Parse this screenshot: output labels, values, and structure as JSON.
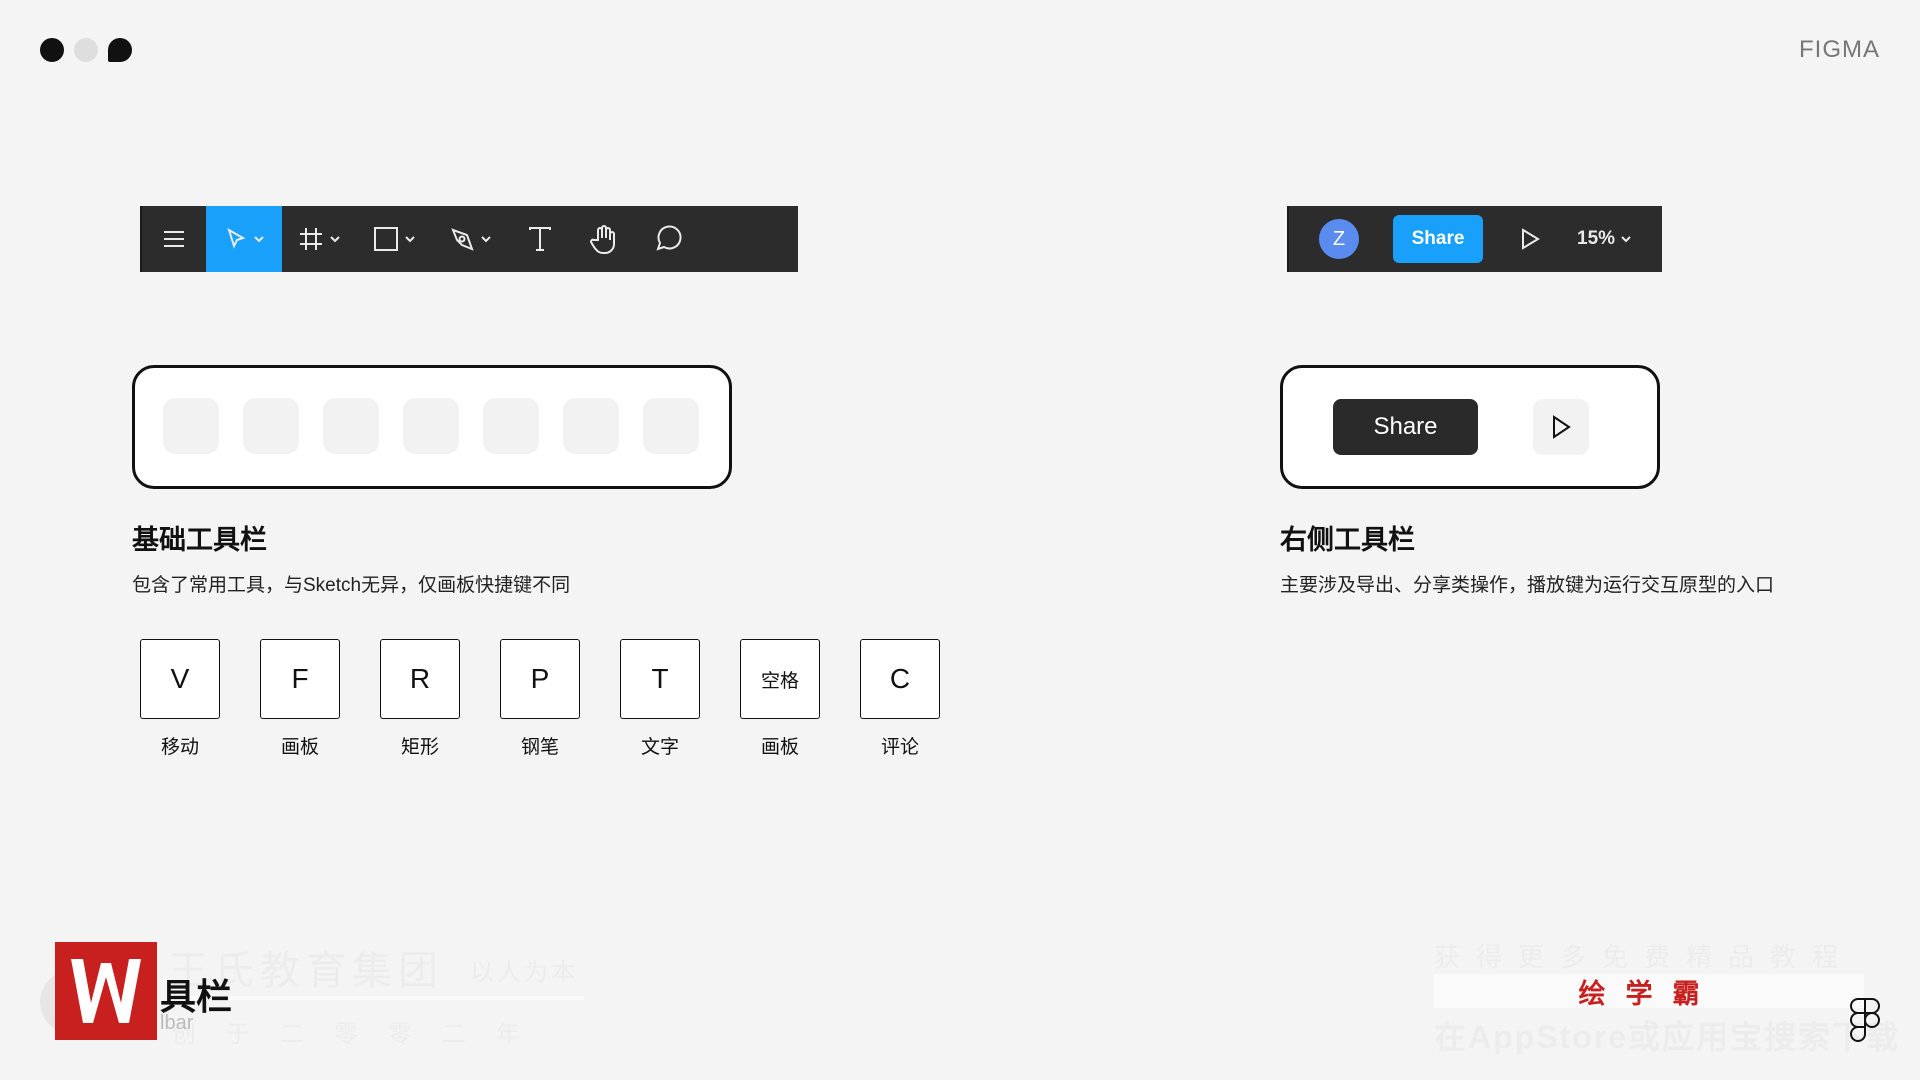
{
  "header": {
    "brand": "FIGMA"
  },
  "toolbar_left": {
    "tools": [
      "menu-icon",
      "move-icon",
      "frame-icon",
      "rectangle-icon",
      "pen-icon",
      "text-icon",
      "hand-icon",
      "comment-icon"
    ]
  },
  "toolbar_right": {
    "avatar_initial": "Z",
    "share_label": "Share",
    "zoom": "15%"
  },
  "basic_toolbar": {
    "title": "基础工具栏",
    "desc": "包含了常用工具，与Sketch无异，仅画板快捷键不同"
  },
  "right_toolbar": {
    "title": "右侧工具栏",
    "desc": "主要涉及导出、分享类操作，播放键为运行交互原型的入口",
    "share_label": "Share"
  },
  "shortcuts": [
    {
      "key": "V",
      "label": "移动"
    },
    {
      "key": "F",
      "label": "画板"
    },
    {
      "key": "R",
      "label": "矩形"
    },
    {
      "key": "P",
      "label": "钢笔"
    },
    {
      "key": "T",
      "label": "文字"
    },
    {
      "key": "空格",
      "label": "画板"
    },
    {
      "key": "C",
      "label": "评论"
    }
  ],
  "watermark": {
    "title": "具栏",
    "sub": "lbar",
    "org": "王氏教育集团",
    "motto": "以人为本",
    "founded": "创于二零零二年",
    "right_top": "获得更多免费精品教程",
    "right_brand": "绘学霸",
    "right_bottom": "在AppStore或应用宝搜索下载"
  },
  "colors": {
    "accent": "#18a0fb",
    "toolbar_bg": "#2c2c2c",
    "avatar": "#5a8cf0",
    "watermark_red": "#c81f1f"
  }
}
